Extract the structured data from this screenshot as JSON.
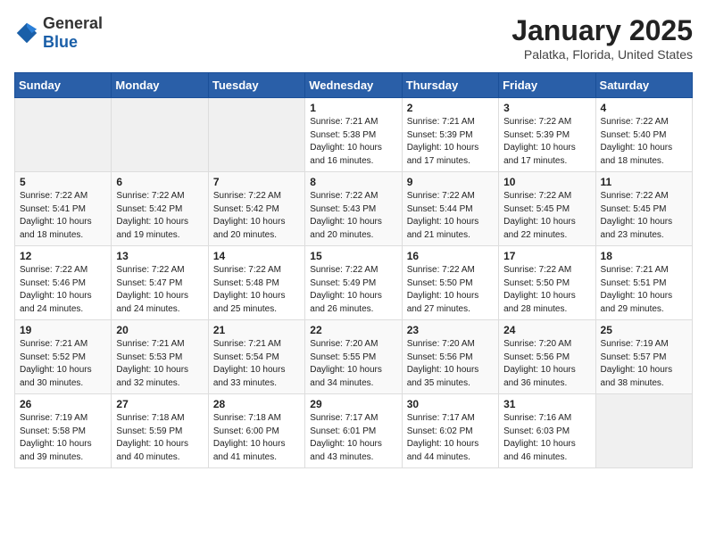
{
  "header": {
    "logo_general": "General",
    "logo_blue": "Blue",
    "month_title": "January 2025",
    "location": "Palatka, Florida, United States"
  },
  "days_of_week": [
    "Sunday",
    "Monday",
    "Tuesday",
    "Wednesday",
    "Thursday",
    "Friday",
    "Saturday"
  ],
  "weeks": [
    [
      {
        "day": "",
        "info": ""
      },
      {
        "day": "",
        "info": ""
      },
      {
        "day": "",
        "info": ""
      },
      {
        "day": "1",
        "info": "Sunrise: 7:21 AM\nSunset: 5:38 PM\nDaylight: 10 hours\nand 16 minutes."
      },
      {
        "day": "2",
        "info": "Sunrise: 7:21 AM\nSunset: 5:39 PM\nDaylight: 10 hours\nand 17 minutes."
      },
      {
        "day": "3",
        "info": "Sunrise: 7:22 AM\nSunset: 5:39 PM\nDaylight: 10 hours\nand 17 minutes."
      },
      {
        "day": "4",
        "info": "Sunrise: 7:22 AM\nSunset: 5:40 PM\nDaylight: 10 hours\nand 18 minutes."
      }
    ],
    [
      {
        "day": "5",
        "info": "Sunrise: 7:22 AM\nSunset: 5:41 PM\nDaylight: 10 hours\nand 18 minutes."
      },
      {
        "day": "6",
        "info": "Sunrise: 7:22 AM\nSunset: 5:42 PM\nDaylight: 10 hours\nand 19 minutes."
      },
      {
        "day": "7",
        "info": "Sunrise: 7:22 AM\nSunset: 5:42 PM\nDaylight: 10 hours\nand 20 minutes."
      },
      {
        "day": "8",
        "info": "Sunrise: 7:22 AM\nSunset: 5:43 PM\nDaylight: 10 hours\nand 20 minutes."
      },
      {
        "day": "9",
        "info": "Sunrise: 7:22 AM\nSunset: 5:44 PM\nDaylight: 10 hours\nand 21 minutes."
      },
      {
        "day": "10",
        "info": "Sunrise: 7:22 AM\nSunset: 5:45 PM\nDaylight: 10 hours\nand 22 minutes."
      },
      {
        "day": "11",
        "info": "Sunrise: 7:22 AM\nSunset: 5:45 PM\nDaylight: 10 hours\nand 23 minutes."
      }
    ],
    [
      {
        "day": "12",
        "info": "Sunrise: 7:22 AM\nSunset: 5:46 PM\nDaylight: 10 hours\nand 24 minutes."
      },
      {
        "day": "13",
        "info": "Sunrise: 7:22 AM\nSunset: 5:47 PM\nDaylight: 10 hours\nand 24 minutes."
      },
      {
        "day": "14",
        "info": "Sunrise: 7:22 AM\nSunset: 5:48 PM\nDaylight: 10 hours\nand 25 minutes."
      },
      {
        "day": "15",
        "info": "Sunrise: 7:22 AM\nSunset: 5:49 PM\nDaylight: 10 hours\nand 26 minutes."
      },
      {
        "day": "16",
        "info": "Sunrise: 7:22 AM\nSunset: 5:50 PM\nDaylight: 10 hours\nand 27 minutes."
      },
      {
        "day": "17",
        "info": "Sunrise: 7:22 AM\nSunset: 5:50 PM\nDaylight: 10 hours\nand 28 minutes."
      },
      {
        "day": "18",
        "info": "Sunrise: 7:21 AM\nSunset: 5:51 PM\nDaylight: 10 hours\nand 29 minutes."
      }
    ],
    [
      {
        "day": "19",
        "info": "Sunrise: 7:21 AM\nSunset: 5:52 PM\nDaylight: 10 hours\nand 30 minutes."
      },
      {
        "day": "20",
        "info": "Sunrise: 7:21 AM\nSunset: 5:53 PM\nDaylight: 10 hours\nand 32 minutes."
      },
      {
        "day": "21",
        "info": "Sunrise: 7:21 AM\nSunset: 5:54 PM\nDaylight: 10 hours\nand 33 minutes."
      },
      {
        "day": "22",
        "info": "Sunrise: 7:20 AM\nSunset: 5:55 PM\nDaylight: 10 hours\nand 34 minutes."
      },
      {
        "day": "23",
        "info": "Sunrise: 7:20 AM\nSunset: 5:56 PM\nDaylight: 10 hours\nand 35 minutes."
      },
      {
        "day": "24",
        "info": "Sunrise: 7:20 AM\nSunset: 5:56 PM\nDaylight: 10 hours\nand 36 minutes."
      },
      {
        "day": "25",
        "info": "Sunrise: 7:19 AM\nSunset: 5:57 PM\nDaylight: 10 hours\nand 38 minutes."
      }
    ],
    [
      {
        "day": "26",
        "info": "Sunrise: 7:19 AM\nSunset: 5:58 PM\nDaylight: 10 hours\nand 39 minutes."
      },
      {
        "day": "27",
        "info": "Sunrise: 7:18 AM\nSunset: 5:59 PM\nDaylight: 10 hours\nand 40 minutes."
      },
      {
        "day": "28",
        "info": "Sunrise: 7:18 AM\nSunset: 6:00 PM\nDaylight: 10 hours\nand 41 minutes."
      },
      {
        "day": "29",
        "info": "Sunrise: 7:17 AM\nSunset: 6:01 PM\nDaylight: 10 hours\nand 43 minutes."
      },
      {
        "day": "30",
        "info": "Sunrise: 7:17 AM\nSunset: 6:02 PM\nDaylight: 10 hours\nand 44 minutes."
      },
      {
        "day": "31",
        "info": "Sunrise: 7:16 AM\nSunset: 6:03 PM\nDaylight: 10 hours\nand 46 minutes."
      },
      {
        "day": "",
        "info": ""
      }
    ]
  ]
}
